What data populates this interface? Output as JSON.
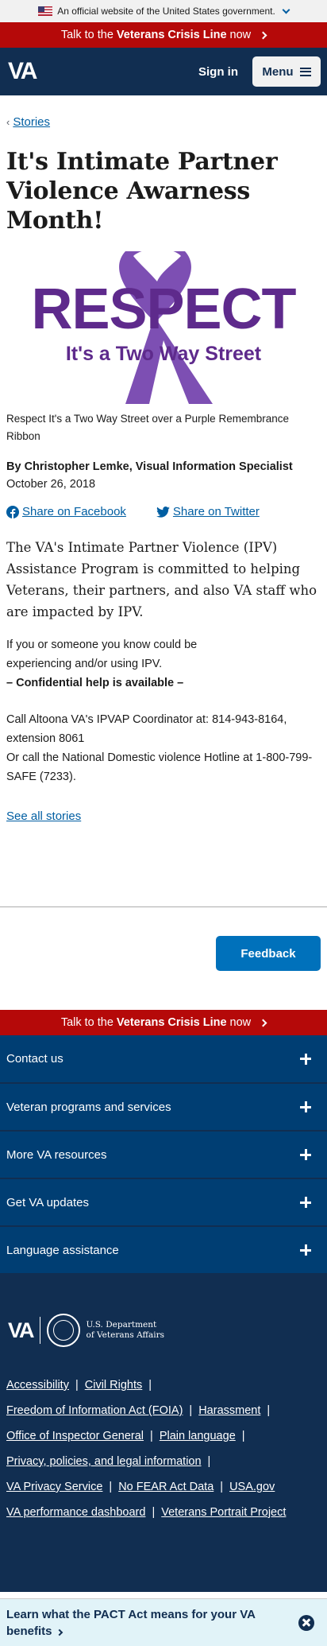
{
  "gov_banner": {
    "text": "An official website of the United States government."
  },
  "crisis": {
    "prefix": "Talk to the ",
    "strong": "Veterans Crisis Line",
    "suffix": " now"
  },
  "header": {
    "logo": "VA",
    "signin": "Sign in",
    "menu": "Menu"
  },
  "breadcrumb": {
    "link": "Stories"
  },
  "article": {
    "title": "It's Intimate Partner Violence Awarness Month!",
    "hero": {
      "line1": "RESPECT",
      "line2": "It's a Two Way Street",
      "accent": "#5e2a8c",
      "ribbon": "#7d4fb3"
    },
    "caption": "Respect It's a Two Way Street over a Purple Remembrance Ribbon",
    "author": "By Christopher Lemke, Visual Information Specialist",
    "date": "October 26, 2018",
    "share_facebook": "Share on Facebook",
    "share_twitter": "Share on Twitter",
    "lead": "The VA's Intimate Partner Violence (IPV) Assistance Program is committed to helping Veterans, their partners, and also VA staff who are impacted by IPV.",
    "p1_line1": "If you or someone you know could be",
    "p1_line2": "experiencing and/or using IPV.",
    "p1_bold": "– Confidential help is available –",
    "p2_line1": "Call Altoona VA's IPVAP Coordinator at: 814-943-8164, extension 8061",
    "p2_line2": "Or call the National Domestic violence Hotline at 1-800-799-SAFE (7233).",
    "see_all": "See all stories"
  },
  "feedback": {
    "label": "Feedback"
  },
  "footer": {
    "accordions": [
      "Contact us",
      "Veteran programs and services",
      "More VA resources",
      "Get VA updates",
      "Language assistance"
    ],
    "brand_va": "VA",
    "dept_line1": "U.S. Department",
    "dept_line2": "of Veterans Affairs",
    "links": {
      "accessibility": "Accessibility",
      "civil_rights": "Civil Rights",
      "foia": "Freedom of Information Act (FOIA)",
      "harassment": "Harassment",
      "oig": "Office of Inspector General",
      "plain_language": "Plain language",
      "privacy": "Privacy, policies, and legal information",
      "privacy_service": "VA Privacy Service",
      "no_fear": "No FEAR Act Data",
      "usagov": "USA.gov",
      "dashboard": "VA performance dashboard",
      "portrait": "Veterans Portrait Project"
    }
  },
  "pact": {
    "text": "Learn what the PACT Act means for your VA benefits"
  },
  "colors": {
    "navy": "#112e51",
    "crisis_red": "#b50909",
    "link_blue": "#005ea2",
    "button_blue": "#0071bb"
  }
}
